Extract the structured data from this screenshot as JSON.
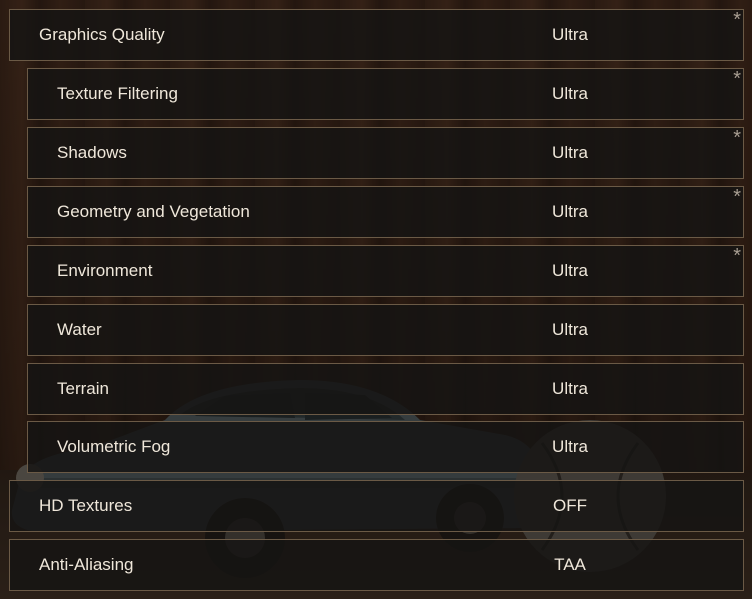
{
  "settings": [
    {
      "label": "Graphics Quality",
      "value": "Ultra",
      "indent": false,
      "marker": "*"
    },
    {
      "label": "Texture Filtering",
      "value": "Ultra",
      "indent": true,
      "marker": "*"
    },
    {
      "label": "Shadows",
      "value": "Ultra",
      "indent": true,
      "marker": "*"
    },
    {
      "label": "Geometry and Vegetation",
      "value": "Ultra",
      "indent": true,
      "marker": "*"
    },
    {
      "label": "Environment",
      "value": "Ultra",
      "indent": true,
      "marker": "*"
    },
    {
      "label": "Water",
      "value": "Ultra",
      "indent": true,
      "marker": ""
    },
    {
      "label": "Terrain",
      "value": "Ultra",
      "indent": true,
      "marker": ""
    },
    {
      "label": "Volumetric Fog",
      "value": "Ultra",
      "indent": true,
      "marker": ""
    },
    {
      "label": "HD Textures",
      "value": "OFF",
      "indent": false,
      "marker": ""
    },
    {
      "label": "Anti-Aliasing",
      "value": "TAA",
      "indent": false,
      "marker": ""
    }
  ]
}
